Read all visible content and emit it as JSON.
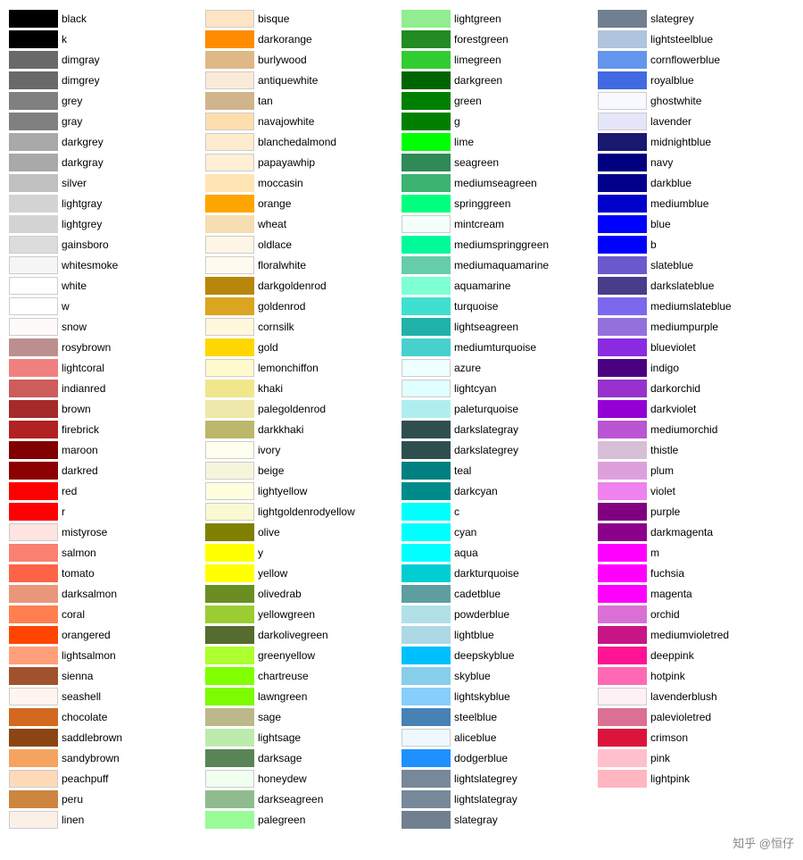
{
  "columns": [
    {
      "items": [
        {
          "name": "black",
          "color": "#000000"
        },
        {
          "name": "k",
          "color": "#000000"
        },
        {
          "name": "dimgray",
          "color": "#696969"
        },
        {
          "name": "dimgrey",
          "color": "#696969"
        },
        {
          "name": "grey",
          "color": "#808080"
        },
        {
          "name": "gray",
          "color": "#808080"
        },
        {
          "name": "darkgrey",
          "color": "#a9a9a9"
        },
        {
          "name": "darkgray",
          "color": "#a9a9a9"
        },
        {
          "name": "silver",
          "color": "#c0c0c0"
        },
        {
          "name": "lightgray",
          "color": "#d3d3d3"
        },
        {
          "name": "lightgrey",
          "color": "#d3d3d3"
        },
        {
          "name": "gainsboro",
          "color": "#dcdcdc"
        },
        {
          "name": "whitesmoke",
          "color": "#f5f5f5"
        },
        {
          "name": "white",
          "color": "#ffffff"
        },
        {
          "name": "w",
          "color": "#ffffff"
        },
        {
          "name": "snow",
          "color": "#fffafa"
        },
        {
          "name": "rosybrown",
          "color": "#bc8f8f"
        },
        {
          "name": "lightcoral",
          "color": "#f08080"
        },
        {
          "name": "indianred",
          "color": "#cd5c5c"
        },
        {
          "name": "brown",
          "color": "#a52a2a"
        },
        {
          "name": "firebrick",
          "color": "#b22222"
        },
        {
          "name": "maroon",
          "color": "#800000"
        },
        {
          "name": "darkred",
          "color": "#8b0000"
        },
        {
          "name": "red",
          "color": "#ff0000"
        },
        {
          "name": "r",
          "color": "#ff0000"
        },
        {
          "name": "mistyrose",
          "color": "#ffe4e1"
        },
        {
          "name": "salmon",
          "color": "#fa8072"
        },
        {
          "name": "tomato",
          "color": "#ff6347"
        },
        {
          "name": "darksalmon",
          "color": "#e9967a"
        },
        {
          "name": "coral",
          "color": "#ff7f50"
        },
        {
          "name": "orangered",
          "color": "#ff4500"
        },
        {
          "name": "lightsalmon",
          "color": "#ffa07a"
        },
        {
          "name": "sienna",
          "color": "#a0522d"
        },
        {
          "name": "seashell",
          "color": "#fff5ee"
        },
        {
          "name": "chocolate",
          "color": "#d2691e"
        },
        {
          "name": "saddlebrown",
          "color": "#8b4513"
        },
        {
          "name": "sandybrown",
          "color": "#f4a460"
        },
        {
          "name": "peachpuff",
          "color": "#ffdab9"
        },
        {
          "name": "peru",
          "color": "#cd853f"
        },
        {
          "name": "linen",
          "color": "#faf0e6"
        }
      ]
    },
    {
      "items": [
        {
          "name": "bisque",
          "color": "#ffe4c4"
        },
        {
          "name": "darkorange",
          "color": "#ff8c00"
        },
        {
          "name": "burlywood",
          "color": "#deb887"
        },
        {
          "name": "antiquewhite",
          "color": "#faebd7"
        },
        {
          "name": "tan",
          "color": "#d2b48c"
        },
        {
          "name": "navajowhite",
          "color": "#ffdead"
        },
        {
          "name": "blanchedalmond",
          "color": "#ffebcd"
        },
        {
          "name": "papayawhip",
          "color": "#ffefd5"
        },
        {
          "name": "moccasin",
          "color": "#ffe4b5"
        },
        {
          "name": "orange",
          "color": "#ffa500"
        },
        {
          "name": "wheat",
          "color": "#f5deb3"
        },
        {
          "name": "oldlace",
          "color": "#fdf5e6"
        },
        {
          "name": "floralwhite",
          "color": "#fffaf0"
        },
        {
          "name": "darkgoldenrod",
          "color": "#b8860b"
        },
        {
          "name": "goldenrod",
          "color": "#daa520"
        },
        {
          "name": "cornsilk",
          "color": "#fff8dc"
        },
        {
          "name": "gold",
          "color": "#ffd700"
        },
        {
          "name": "lemonchiffon",
          "color": "#fffacd"
        },
        {
          "name": "khaki",
          "color": "#f0e68c"
        },
        {
          "name": "palegoldenrod",
          "color": "#eee8aa"
        },
        {
          "name": "darkkhaki",
          "color": "#bdb76b"
        },
        {
          "name": "ivory",
          "color": "#fffff0"
        },
        {
          "name": "beige",
          "color": "#f5f5dc"
        },
        {
          "name": "lightyellow",
          "color": "#ffffe0"
        },
        {
          "name": "lightgoldenrodyellow",
          "color": "#fafad2"
        },
        {
          "name": "olive",
          "color": "#808000"
        },
        {
          "name": "y",
          "color": "#ffff00"
        },
        {
          "name": "yellow",
          "color": "#ffff00"
        },
        {
          "name": "olivedrab",
          "color": "#6b8e23"
        },
        {
          "name": "yellowgreen",
          "color": "#9acd32"
        },
        {
          "name": "darkolivegreen",
          "color": "#556b2f"
        },
        {
          "name": "greenyellow",
          "color": "#adff2f"
        },
        {
          "name": "chartreuse",
          "color": "#7fff00"
        },
        {
          "name": "lawngreen",
          "color": "#7cfc00"
        },
        {
          "name": "sage",
          "color": "#bcb88a"
        },
        {
          "name": "lightsage",
          "color": "#bcecac"
        },
        {
          "name": "darksage",
          "color": "#598556"
        },
        {
          "name": "honeydew",
          "color": "#f0fff0"
        },
        {
          "name": "darkseagreen",
          "color": "#8fbc8f"
        },
        {
          "name": "palegreen",
          "color": "#98fb98"
        }
      ]
    },
    {
      "items": [
        {
          "name": "lightgreen",
          "color": "#90ee90"
        },
        {
          "name": "forestgreen",
          "color": "#228b22"
        },
        {
          "name": "limegreen",
          "color": "#32cd32"
        },
        {
          "name": "darkgreen",
          "color": "#006400"
        },
        {
          "name": "green",
          "color": "#008000"
        },
        {
          "name": "g",
          "color": "#008000"
        },
        {
          "name": "lime",
          "color": "#00ff00"
        },
        {
          "name": "seagreen",
          "color": "#2e8b57"
        },
        {
          "name": "mediumseagreen",
          "color": "#3cb371"
        },
        {
          "name": "springgreen",
          "color": "#00ff7f"
        },
        {
          "name": "mintcream",
          "color": "#f5fffa"
        },
        {
          "name": "mediumspringgreen",
          "color": "#00fa9a"
        },
        {
          "name": "mediumaquamarine",
          "color": "#66cdaa"
        },
        {
          "name": "aquamarine",
          "color": "#7fffd4"
        },
        {
          "name": "turquoise",
          "color": "#40e0d0"
        },
        {
          "name": "lightseagreen",
          "color": "#20b2aa"
        },
        {
          "name": "mediumturquoise",
          "color": "#48d1cc"
        },
        {
          "name": "azure",
          "color": "#f0ffff"
        },
        {
          "name": "lightcyan",
          "color": "#e0ffff"
        },
        {
          "name": "paleturquoise",
          "color": "#afeeee"
        },
        {
          "name": "darkslategray",
          "color": "#2f4f4f"
        },
        {
          "name": "darkslategrey",
          "color": "#2f4f4f"
        },
        {
          "name": "teal",
          "color": "#008080"
        },
        {
          "name": "darkcyan",
          "color": "#008b8b"
        },
        {
          "name": "c",
          "color": "#00ffff"
        },
        {
          "name": "cyan",
          "color": "#00ffff"
        },
        {
          "name": "aqua",
          "color": "#00ffff"
        },
        {
          "name": "darkturquoise",
          "color": "#00ced1"
        },
        {
          "name": "cadetblue",
          "color": "#5f9ea0"
        },
        {
          "name": "powderblue",
          "color": "#b0e0e6"
        },
        {
          "name": "lightblue",
          "color": "#add8e6"
        },
        {
          "name": "deepskyblue",
          "color": "#00bfff"
        },
        {
          "name": "skyblue",
          "color": "#87ceeb"
        },
        {
          "name": "lightskyblue",
          "color": "#87cefa"
        },
        {
          "name": "steelblue",
          "color": "#4682b4"
        },
        {
          "name": "aliceblue",
          "color": "#f0f8ff"
        },
        {
          "name": "dodgerblue",
          "color": "#1e90ff"
        },
        {
          "name": "lightslategrey",
          "color": "#778899"
        },
        {
          "name": "lightslategray",
          "color": "#778899"
        },
        {
          "name": "slategray",
          "color": "#708090"
        }
      ]
    },
    {
      "items": [
        {
          "name": "slategrey",
          "color": "#708090"
        },
        {
          "name": "lightsteelblue",
          "color": "#b0c4de"
        },
        {
          "name": "cornflowerblue",
          "color": "#6495ed"
        },
        {
          "name": "royalblue",
          "color": "#4169e1"
        },
        {
          "name": "ghostwhite",
          "color": "#f8f8ff"
        },
        {
          "name": "lavender",
          "color": "#e6e6fa"
        },
        {
          "name": "midnightblue",
          "color": "#191970"
        },
        {
          "name": "navy",
          "color": "#000080"
        },
        {
          "name": "darkblue",
          "color": "#00008b"
        },
        {
          "name": "mediumblue",
          "color": "#0000cd"
        },
        {
          "name": "blue",
          "color": "#0000ff"
        },
        {
          "name": "b",
          "color": "#0000ff"
        },
        {
          "name": "slateblue",
          "color": "#6a5acd"
        },
        {
          "name": "darkslateblue",
          "color": "#483d8b"
        },
        {
          "name": "mediumslateblue",
          "color": "#7b68ee"
        },
        {
          "name": "mediumpurple",
          "color": "#9370db"
        },
        {
          "name": "blueviolet",
          "color": "#8a2be2"
        },
        {
          "name": "indigo",
          "color": "#4b0082"
        },
        {
          "name": "darkorchid",
          "color": "#9932cc"
        },
        {
          "name": "darkviolet",
          "color": "#9400d3"
        },
        {
          "name": "mediumorchid",
          "color": "#ba55d3"
        },
        {
          "name": "thistle",
          "color": "#d8bfd8"
        },
        {
          "name": "plum",
          "color": "#dda0dd"
        },
        {
          "name": "violet",
          "color": "#ee82ee"
        },
        {
          "name": "purple",
          "color": "#800080"
        },
        {
          "name": "darkmagenta",
          "color": "#8b008b"
        },
        {
          "name": "m",
          "color": "#ff00ff"
        },
        {
          "name": "fuchsia",
          "color": "#ff00ff"
        },
        {
          "name": "magenta",
          "color": "#ff00ff"
        },
        {
          "name": "orchid",
          "color": "#da70d6"
        },
        {
          "name": "mediumvioletred",
          "color": "#c71585"
        },
        {
          "name": "deeppink",
          "color": "#ff1493"
        },
        {
          "name": "hotpink",
          "color": "#ff69b4"
        },
        {
          "name": "lavenderblush",
          "color": "#fff0f5"
        },
        {
          "name": "palevioletred",
          "color": "#db7093"
        },
        {
          "name": "crimson",
          "color": "#dc143c"
        },
        {
          "name": "pink",
          "color": "#ffc0cb"
        },
        {
          "name": "lightpink",
          "color": "#ffb6c1"
        },
        {
          "name": "",
          "color": ""
        },
        {
          "name": "",
          "color": ""
        }
      ]
    }
  ],
  "watermark": "知乎 @恒仔"
}
